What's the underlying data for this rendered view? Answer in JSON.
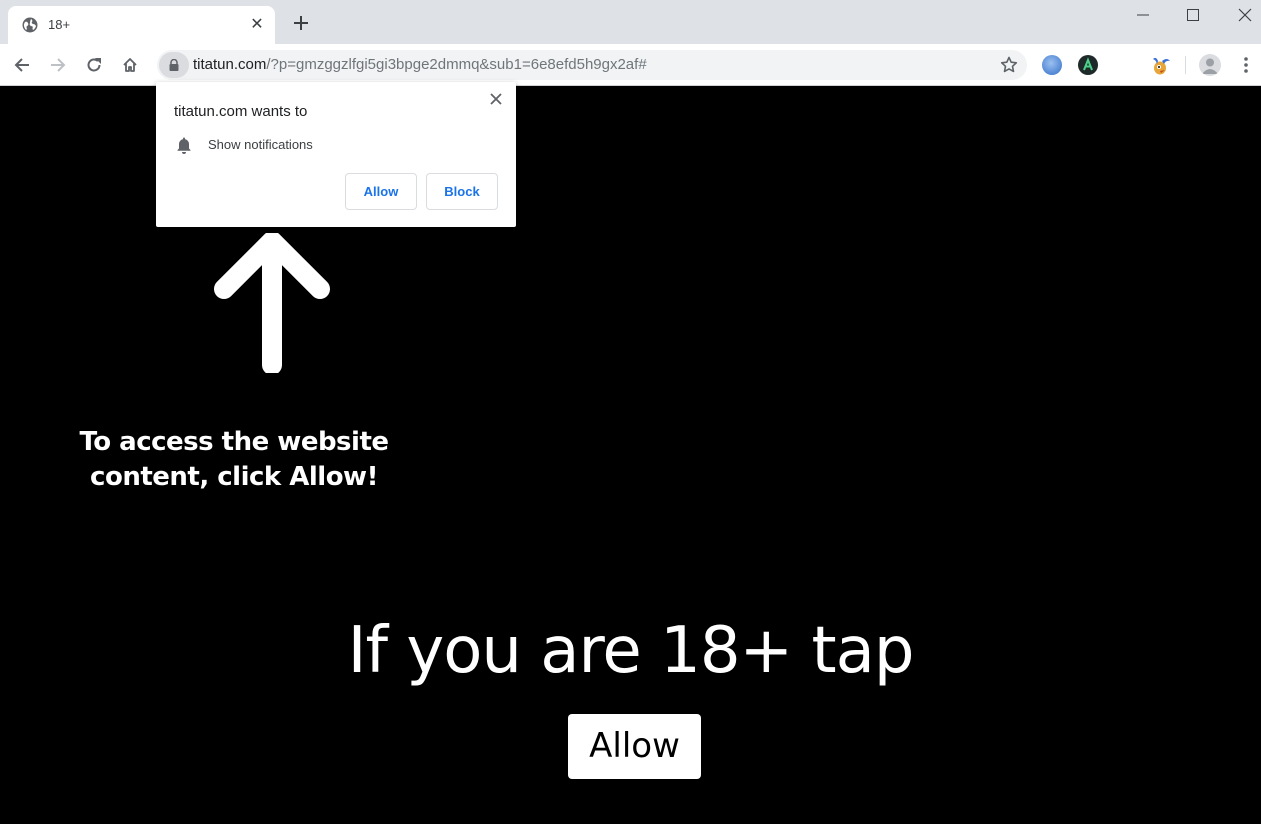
{
  "browser": {
    "tab": {
      "title": "18+",
      "favicon": "globe-icon",
      "close_icon": "close-icon"
    },
    "new_tab_icon": "plus-icon",
    "window_controls": [
      "minimize-icon",
      "maximize-icon",
      "close-icon"
    ],
    "toolbar": {
      "back_icon": "arrow-left-icon",
      "forward_icon": "arrow-right-icon",
      "reload_icon": "reload-icon",
      "home_icon": "home-icon",
      "address": {
        "security_icon": "lock-icon",
        "host": "titatun.com",
        "path": "/?p=gmzggzlfgi5gi3bpge2dmmq&sub1=6e8efd5h9gx2af#"
      },
      "bookmark_icon": "star-icon",
      "extensions": [
        "blue-circle-extension-icon",
        "dark-a-extension-icon",
        "cartoon-bird-extension-icon"
      ],
      "profile_icon": "avatar-icon",
      "menu_icon": "more-vert-icon"
    }
  },
  "permission_prompt": {
    "title": "titatun.com wants to",
    "permission_icon": "bell-icon",
    "permission": "Show notifications",
    "allow_label": "Allow",
    "block_label": "Block",
    "accent_color": "#1a73e8"
  },
  "page": {
    "arrow_icon": "arrow-up-icon",
    "instruction_line1": "To access the website",
    "instruction_line2": "content, click Allow!",
    "headline": "If you are 18+ tap",
    "allow_button": "Allow",
    "background_color": "#000000"
  }
}
